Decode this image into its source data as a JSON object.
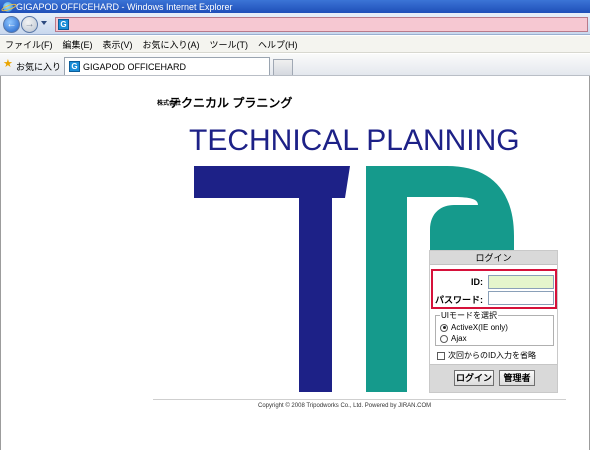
{
  "window": {
    "title": "GIGAPOD OFFICEHARD - Windows Internet Explorer",
    "address_icon": "G"
  },
  "menu": {
    "items": [
      "ファイル(F)",
      "編集(E)",
      "表示(V)",
      "お気に入り(A)",
      "ツール(T)",
      "ヘルプ(H)"
    ]
  },
  "favorites": {
    "label": "お気に入り",
    "tab_title": "GIGAPOD OFFICEHARD",
    "tab_icon": "G"
  },
  "page": {
    "company_prefix": "株式会社",
    "company_name": "テクニカル プラニング",
    "brand_title": "TECHNICAL   PLANNING",
    "copyright": "Copyright © 2008 Tripodworks Co., Ltd. Powered by JIRAN.COM"
  },
  "login": {
    "header": "ログイン",
    "id_label": "ID:",
    "password_label": "パスワード:",
    "id_value": "",
    "password_value": "",
    "mode_legend": "UIモードを選択",
    "mode_options": [
      "ActiveX(IE only)",
      "Ajax"
    ],
    "selected_mode": "ActiveX(IE only)",
    "skip_id_label": "次回からのID入力を省略",
    "login_button": "ログイン",
    "admin_button": "管理者"
  },
  "colors": {
    "brand_navy": "#1d2187",
    "brand_teal": "#159a8c",
    "highlight_red": "#d6113a",
    "address_bar": "#f6c8d2"
  },
  "icons": [
    "ie-logo-icon",
    "back-arrow-icon",
    "forward-arrow-icon",
    "favorites-star-icon",
    "site-favicon-icon"
  ]
}
